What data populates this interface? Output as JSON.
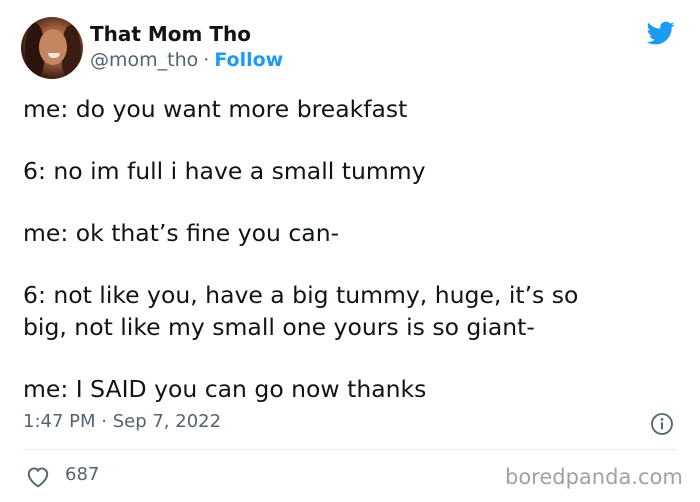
{
  "author": {
    "display_name": "That Mom Tho",
    "handle": "@mom_tho",
    "separator": "·",
    "follow_label": "Follow"
  },
  "tweet": {
    "lines": [
      "me: do you want more breakfast",
      "6: no im full i have a small tummy",
      "me: ok that’s fine you can-",
      "6: not like you, have a big tummy, huge, it’s so",
      "big, not like my small one yours is so giant-",
      "me: I SAID you can go now thanks"
    ],
    "timestamp": "1:47 PM · Sep 7, 2022"
  },
  "engagement": {
    "like_count": "687"
  },
  "watermark": "boredpanda.com",
  "icons": {
    "brand": "twitter-bird-icon",
    "info": "info-icon",
    "like": "heart-icon"
  },
  "colors": {
    "accent": "#1d9bf0",
    "text": "#0f1419",
    "muted": "#536471"
  }
}
